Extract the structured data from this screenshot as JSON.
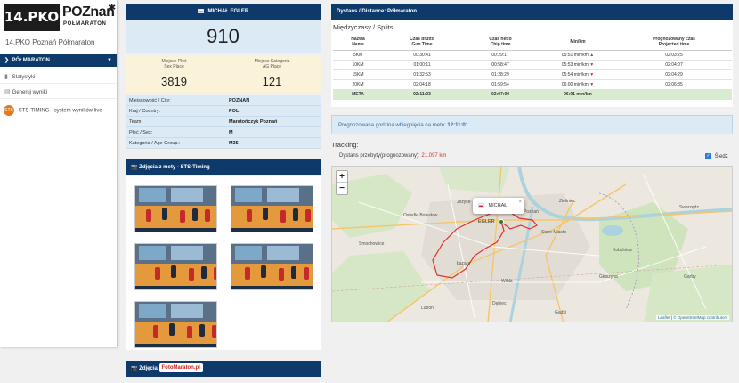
{
  "sidebar": {
    "logo_left": "14.PKO",
    "logo_right": "POZnan",
    "logo_sub": "PÓŁMARATON",
    "event_title": "14.PKO Poznań Półmaraton",
    "active_item": "PÓŁMARATON",
    "items": [
      {
        "icon": "chart-icon",
        "label": "Statystyki"
      },
      {
        "icon": "document-icon",
        "label": "Generuj wyniki"
      }
    ],
    "sts_label": "STS-TIMING - system wyników live",
    "sts_mark": "STS"
  },
  "runner": {
    "name": "MICHAŁ EGLER",
    "bib": "910",
    "place_label": "Miejsce Płeć\nSex Place",
    "place_value": "3819",
    "cat_place_label": "Miejsce Kategoria\nAG Place",
    "cat_place_value": "121",
    "info": [
      {
        "k": "Miejscowość / City:",
        "v": "POZNAŃ"
      },
      {
        "k": "Kraj / Country:",
        "v": "POL"
      },
      {
        "k": "Team",
        "v": "Maratończyk Poznań"
      },
      {
        "k": "Płeć / Sex:",
        "v": "M"
      },
      {
        "k": "Kategoria / Age Group.:",
        "v": "M35"
      }
    ]
  },
  "photos": {
    "title": "Zdjęcia z mety - STS-Timing",
    "count": 5
  },
  "bottom": {
    "title": "Zdjęcia",
    "brand": "FotoMaraton.pl"
  },
  "distance": {
    "label": "Dystans / Distance:",
    "value": "Półmaraton"
  },
  "splits": {
    "title": "Międzyczasy / Splits:",
    "headers": [
      "Nazwa\nName",
      "Czas brutto\nGun Time",
      "Czas netto\nChip time",
      "Min/km",
      "Prognozowany czas\nProjected time"
    ],
    "rows": [
      {
        "name": "5KM",
        "gun": "00:30:41",
        "chip": "00:29:17",
        "pace": "05:51 min/km",
        "trend": "up",
        "proj": "02:03:25"
      },
      {
        "name": "10KM",
        "gun": "01:00:11",
        "chip": "00:58:47",
        "pace": "05:53 min/km",
        "trend": "down",
        "proj": "02:04:07"
      },
      {
        "name": "15KM",
        "gun": "01:32:53",
        "chip": "01:28:29",
        "pace": "05:54 min/km",
        "trend": "down",
        "proj": "02:04:29"
      },
      {
        "name": "20KM",
        "gun": "02:04:18",
        "chip": "01:59:54",
        "pace": "06:00 min/km",
        "trend": "down",
        "proj": "02:06:35"
      },
      {
        "name": "META",
        "gun": "02:11:23",
        "chip": "02:07:00",
        "pace": "06:01 min/km",
        "trend": "",
        "proj": ""
      }
    ]
  },
  "projection": {
    "label": "Prognozowana godzina wbiegnięcia na metę:",
    "value": "12:11:01"
  },
  "tracking": {
    "title": "Tracking:",
    "distance_label": "Dystans przebyty(prognozowany):",
    "distance_value": "21.097 km",
    "follow_label": "Śledź"
  },
  "map": {
    "popup_name": "MICHAŁ EGLER",
    "attribution_leaflet": "Leaflet",
    "attribution_osm": "© OpenStreetMap contributors",
    "place_labels": [
      "Osiedle Bolesław",
      "Jeżyce",
      "Poznań",
      "Smochowice",
      "Łazarz",
      "Wilda",
      "Dębiec",
      "Garby",
      "Swarzędz",
      "Kobylnica",
      "Głuszyna",
      "Luboń",
      "Gądki",
      "Stare Miasto",
      "Zieliniec"
    ],
    "accent_route": "#e0322b",
    "water": "#aad3df",
    "green": "#c8e2b5"
  },
  "colors": {
    "navy": "#0e3a6b",
    "light_blue": "#dceaf6",
    "cream": "#fbf3d9"
  }
}
